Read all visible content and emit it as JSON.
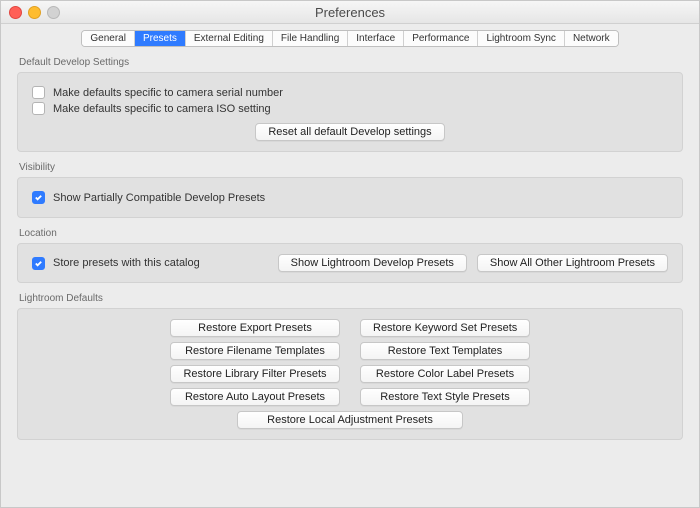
{
  "window": {
    "title": "Preferences"
  },
  "tabs": [
    {
      "label": "General"
    },
    {
      "label": "Presets"
    },
    {
      "label": "External Editing"
    },
    {
      "label": "File Handling"
    },
    {
      "label": "Interface"
    },
    {
      "label": "Performance"
    },
    {
      "label": "Lightroom Sync"
    },
    {
      "label": "Network"
    }
  ],
  "defaultDevelop": {
    "title": "Default Develop Settings",
    "serialSpecific": "Make defaults specific to camera serial number",
    "isoSpecific": "Make defaults specific to camera ISO setting",
    "resetButton": "Reset all default Develop settings"
  },
  "visibility": {
    "title": "Visibility",
    "showPartial": "Show Partially Compatible Develop Presets"
  },
  "location": {
    "title": "Location",
    "storeWithCatalog": "Store presets with this catalog",
    "showDevelop": "Show Lightroom Develop Presets",
    "showOther": "Show All Other Lightroom Presets"
  },
  "lightroomDefaults": {
    "title": "Lightroom Defaults",
    "restoreExport": "Restore Export Presets",
    "restoreKeyword": "Restore Keyword Set Presets",
    "restoreFilename": "Restore Filename Templates",
    "restoreText": "Restore Text Templates",
    "restoreLibraryFilter": "Restore Library Filter Presets",
    "restoreColorLabel": "Restore Color Label Presets",
    "restoreAutoLayout": "Restore Auto Layout Presets",
    "restoreTextStyle": "Restore Text Style Presets",
    "restoreLocalAdj": "Restore Local Adjustment Presets"
  }
}
